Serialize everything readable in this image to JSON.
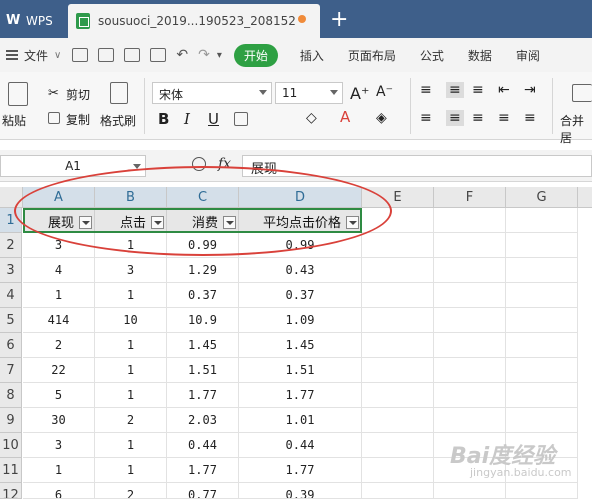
{
  "titlebar": {
    "app_name": "WPS",
    "doc_tab_title": "sousuoci_2019...190523_208152",
    "new_tab_symbol": "+"
  },
  "menubar": {
    "file_label": "文件",
    "start_label": "开始",
    "tabs": [
      "插入",
      "页面布局",
      "公式",
      "数据",
      "审阅"
    ]
  },
  "ribbon": {
    "paste": "粘贴",
    "cut": "剪切",
    "copy": "复制",
    "format_painter": "格式刷",
    "font_name": "宋体",
    "font_size": "11",
    "bold": "B",
    "italic": "I",
    "underline": "U",
    "merge_center": "合并居"
  },
  "formulabar": {
    "name_box": "A1",
    "fx": "fx",
    "content": "展现"
  },
  "grid": {
    "columns": [
      "A",
      "B",
      "C",
      "D",
      "E",
      "F",
      "G"
    ],
    "rows": [
      "1",
      "2",
      "3",
      "4",
      "5",
      "6",
      "7",
      "8",
      "9",
      "10",
      "11",
      "12"
    ],
    "headers": [
      "展现",
      "点击",
      "消费",
      "平均点击价格"
    ],
    "data": [
      [
        "3",
        "1",
        "0.99",
        "0.99"
      ],
      [
        "4",
        "3",
        "1.29",
        "0.43"
      ],
      [
        "1",
        "1",
        "0.37",
        "0.37"
      ],
      [
        "414",
        "10",
        "10.9",
        "1.09"
      ],
      [
        "2",
        "1",
        "1.45",
        "1.45"
      ],
      [
        "22",
        "1",
        "1.51",
        "1.51"
      ],
      [
        "5",
        "1",
        "1.77",
        "1.77"
      ],
      [
        "30",
        "2",
        "2.03",
        "1.01"
      ],
      [
        "3",
        "1",
        "0.44",
        "0.44"
      ],
      [
        "1",
        "1",
        "1.77",
        "1.77"
      ],
      [
        "6",
        "2",
        "0.77",
        "0.39"
      ]
    ]
  },
  "watermark": {
    "main": "Bai度经验",
    "sub": "jingyan.baidu.com"
  },
  "colors": {
    "titlebar": "#3e5f8a",
    "accent_green": "#2ea043",
    "annotation_red": "#d9413a",
    "modified_dot": "#f08b3a"
  }
}
